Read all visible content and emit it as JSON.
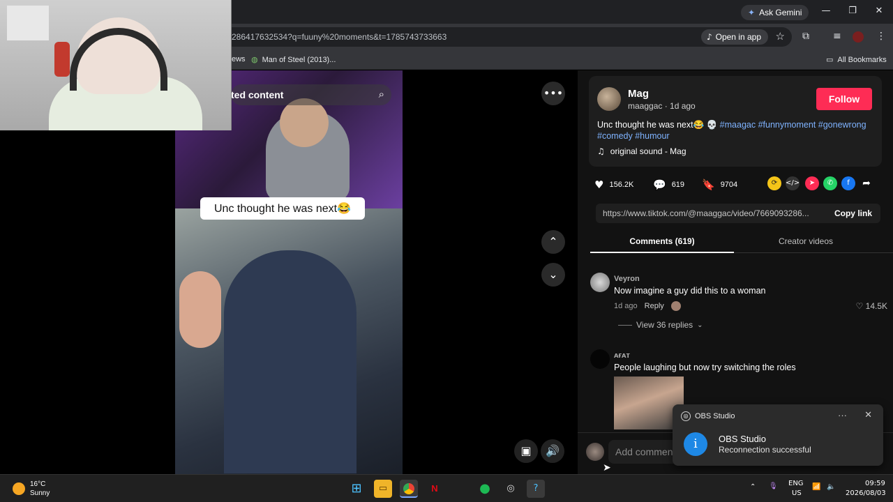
{
  "titlebar": {
    "ask_gemini": "Ask Gemini"
  },
  "toolbar": {
    "url": "286417632534?q=fuuny%20moments&t=1785743733663",
    "open_in_app": "Open in app"
  },
  "bookmarks": [
    {
      "label": "ews"
    },
    {
      "label": "Man of Steel (2013)..."
    },
    {
      "label": "All Bookmarks"
    }
  ],
  "video": {
    "search_text": "ted content",
    "caption": "Unc thought he was next😂"
  },
  "post": {
    "author_name": "Mag",
    "author_handle": "maaggac · 1d ago",
    "follow_label": "Follow",
    "desc_text": "Unc thought he was next😂 💀",
    "tags": [
      "#maagac",
      "#funnymoment",
      "#gonewrong",
      "#comedy",
      "#humour"
    ],
    "sound": "original sound - Mag",
    "likes": "156.2K",
    "comments": "619",
    "saves": "9704",
    "link": "https://www.tiktok.com/@maaggac/video/7669093286...",
    "copy_link": "Copy link"
  },
  "tabs": {
    "comments": "Comments (619)",
    "creator": "Creator videos"
  },
  "comments": [
    {
      "user": "Veyron",
      "text": "Now imagine a guy did this to a woman",
      "age": "1d ago",
      "reply": "Reply",
      "likes": "14.5K",
      "view_replies": "View 36 replies"
    },
    {
      "user": "ᴀғᴀᴛ",
      "text": "People laughing but now try switching the roles"
    }
  ],
  "add_comment_placeholder": "Add comment...",
  "toast": {
    "app": "OBS Studio",
    "title": "OBS Studio",
    "body": "Reconnection successful"
  },
  "taskbar": {
    "temp": "16°C",
    "weather": "Sunny",
    "lang1": "ENG",
    "lang2": "US",
    "time": "09:59",
    "date": "2026/08/03"
  },
  "colors": {
    "follow": "#fe2c55",
    "tag": "#7fb3ff",
    "info": "#1e88e5"
  }
}
